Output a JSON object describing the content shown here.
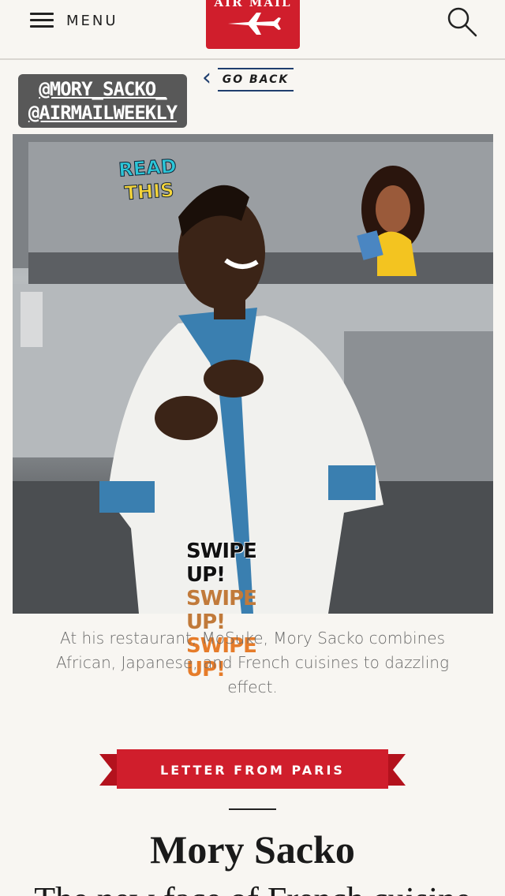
{
  "header": {
    "menu_label": "MENU",
    "logo_text": "AIR MAIL"
  },
  "story_overlay": {
    "handle_1": "@MORY_SACKO_",
    "handle_2": "@AIRMAILWEEKLY",
    "go_back_label": "GO BACK",
    "read_line_1": "READ",
    "read_line_2": "THIS",
    "swipe_lines": [
      "SWIPE UP!",
      "SWIPE UP!",
      "SWIPE UP!"
    ]
  },
  "article": {
    "caption": "At his restaurant, MoSuke, Mory Sacko combines African, Japanese, and French cuisines to dazzling effect.",
    "section_ribbon": "LETTER FROM PARIS",
    "headline": "Mory Sacko",
    "dek": "The new face of French cuisine"
  },
  "colors": {
    "brand_red": "#d01e2c",
    "background": "#f8f6f2",
    "go_back_blue": "#1f3e6e"
  }
}
